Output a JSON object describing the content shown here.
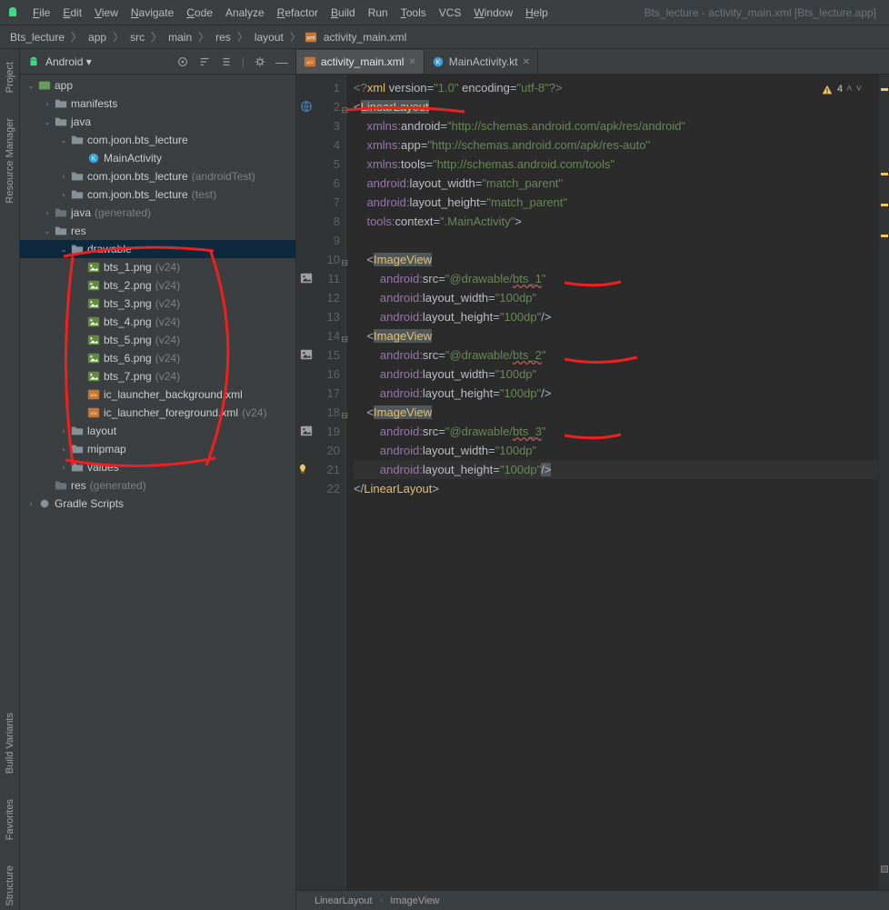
{
  "window": {
    "title": "Bts_lecture - activity_main.xml [Bts_lecture.app]"
  },
  "menu": [
    {
      "lbl": "File",
      "u": 0
    },
    {
      "lbl": "Edit",
      "u": 0
    },
    {
      "lbl": "View",
      "u": 0
    },
    {
      "lbl": "Navigate",
      "u": 0
    },
    {
      "lbl": "Code",
      "u": 0
    },
    {
      "lbl": "Analyze",
      "u": -1
    },
    {
      "lbl": "Refactor",
      "u": 0
    },
    {
      "lbl": "Build",
      "u": 0
    },
    {
      "lbl": "Run",
      "u": -1
    },
    {
      "lbl": "Tools",
      "u": 0
    },
    {
      "lbl": "VCS",
      "u": -1
    },
    {
      "lbl": "Window",
      "u": 0
    },
    {
      "lbl": "Help",
      "u": 0
    }
  ],
  "breadcrumb": [
    "Bts_lecture",
    "app",
    "src",
    "main",
    "res",
    "layout",
    "activity_main.xml"
  ],
  "leftTabs": {
    "top": [
      "Project",
      "Resource Manager"
    ],
    "bottom": [
      "Structure",
      "Favorites",
      "Build Variants"
    ]
  },
  "projHeader": {
    "title": "Android"
  },
  "tree": [
    {
      "d": 0,
      "a": "v",
      "i": "mod",
      "lbl": "app"
    },
    {
      "d": 1,
      "a": ">",
      "i": "fld",
      "lbl": "manifests"
    },
    {
      "d": 1,
      "a": "v",
      "i": "fld",
      "lbl": "java"
    },
    {
      "d": 2,
      "a": "v",
      "i": "fld",
      "lbl": "com.joon.bts_lecture"
    },
    {
      "d": 3,
      "a": "",
      "i": "kt",
      "lbl": "MainActivity"
    },
    {
      "d": 2,
      "a": ">",
      "i": "fld",
      "lbl": "com.joon.bts_lecture",
      "sub": "(androidTest)"
    },
    {
      "d": 2,
      "a": ">",
      "i": "fld",
      "lbl": "com.joon.bts_lecture",
      "sub": "(test)"
    },
    {
      "d": 1,
      "a": ">",
      "i": "fldg",
      "lbl": "java",
      "sub": "(generated)"
    },
    {
      "d": 1,
      "a": "v",
      "i": "fld",
      "lbl": "res"
    },
    {
      "d": 2,
      "a": "v",
      "i": "fld",
      "lbl": "drawable",
      "sel": true
    },
    {
      "d": 3,
      "a": "",
      "i": "img",
      "lbl": "bts_1.png",
      "sub": "(v24)"
    },
    {
      "d": 3,
      "a": "",
      "i": "img",
      "lbl": "bts_2.png",
      "sub": "(v24)"
    },
    {
      "d": 3,
      "a": "",
      "i": "img",
      "lbl": "bts_3.png",
      "sub": "(v24)"
    },
    {
      "d": 3,
      "a": "",
      "i": "img",
      "lbl": "bts_4.png",
      "sub": "(v24)"
    },
    {
      "d": 3,
      "a": "",
      "i": "img",
      "lbl": "bts_5.png",
      "sub": "(v24)"
    },
    {
      "d": 3,
      "a": "",
      "i": "img",
      "lbl": "bts_6.png",
      "sub": "(v24)"
    },
    {
      "d": 3,
      "a": "",
      "i": "img",
      "lbl": "bts_7.png",
      "sub": "(v24)"
    },
    {
      "d": 3,
      "a": "",
      "i": "xml",
      "lbl": "ic_launcher_background.xml"
    },
    {
      "d": 3,
      "a": "",
      "i": "xml",
      "lbl": "ic_launcher_foreground.xml",
      "sub": "(v24)"
    },
    {
      "d": 2,
      "a": ">",
      "i": "fld",
      "lbl": "layout"
    },
    {
      "d": 2,
      "a": ">",
      "i": "fld",
      "lbl": "mipmap"
    },
    {
      "d": 2,
      "a": ">",
      "i": "fld",
      "lbl": "values"
    },
    {
      "d": 1,
      "a": "",
      "i": "fldg",
      "lbl": "res",
      "sub": "(generated)"
    },
    {
      "d": 0,
      "a": ">",
      "i": "grd",
      "lbl": "Gradle Scripts"
    }
  ],
  "tabs": [
    {
      "lbl": "activity_main.xml",
      "icon": "xml",
      "active": true
    },
    {
      "lbl": "MainActivity.kt",
      "icon": "kt",
      "active": false
    }
  ],
  "editor": {
    "lines": [
      {
        "n": 1,
        "html": "<span class='pi'>&lt;?</span><span class='tag'>xml </span><span class='attr'>version</span><span class='op'>=</span><span class='val'>\"1.0\"</span> <span class='attr'>encoding</span><span class='op'>=</span><span class='val'>\"utf-8\"</span><span class='pi'>?&gt;</span>"
      },
      {
        "n": 2,
        "html": "<span class='op'>&lt;</span><span class='tag hl'>LinearLayout</span>",
        "icon": "globe",
        "fold": "-"
      },
      {
        "n": 3,
        "html": "    <span class='ns'>xmlns:</span><span class='attr'>android</span><span class='op'>=</span><span class='val'>\"http://schemas.android.com/apk/res/android\"</span>"
      },
      {
        "n": 4,
        "html": "    <span class='ns'>xmlns:</span><span class='attr'>app</span><span class='op'>=</span><span class='val'>\"http://schemas.android.com/apk/res-auto\"</span>"
      },
      {
        "n": 5,
        "html": "    <span class='ns'>xmlns:</span><span class='attr'>tools</span><span class='op'>=</span><span class='val'>\"http://schemas.android.com/tools\"</span>"
      },
      {
        "n": 6,
        "html": "    <span class='ns'>android:</span><span class='attr'>layout_width</span><span class='op'>=</span><span class='val'>\"match_parent\"</span>"
      },
      {
        "n": 7,
        "html": "    <span class='ns'>android:</span><span class='attr'>layout_height</span><span class='op'>=</span><span class='val'>\"match_parent\"</span>"
      },
      {
        "n": 8,
        "html": "    <span class='ns'>tools:</span><span class='attr'>context</span><span class='op'>=</span><span class='val'>\".MainActivity\"</span><span class='op'>&gt;</span>"
      },
      {
        "n": 9,
        "html": ""
      },
      {
        "n": 10,
        "html": "    <span class='op'>&lt;</span><span class='tag hl'>ImageView</span>",
        "fold": "-"
      },
      {
        "n": 11,
        "html": "        <span class='ns'>android:</span><span class='attr'>src</span><span class='op'>=</span><span class='val'>\"@drawable/<span class='err'>bts_1</span>\"</span>",
        "icon": "img"
      },
      {
        "n": 12,
        "html": "        <span class='ns'>android:</span><span class='attr'>layout_width</span><span class='op'>=</span><span class='val'>\"100dp\"</span>"
      },
      {
        "n": 13,
        "html": "        <span class='ns'>android:</span><span class='attr'>layout_height</span><span class='op'>=</span><span class='val'>\"100dp\"</span><span class='op'>/&gt;</span>",
        "fold": "–"
      },
      {
        "n": 14,
        "html": "    <span class='op'>&lt;</span><span class='tag hl'>ImageView</span>",
        "fold": "-"
      },
      {
        "n": 15,
        "html": "        <span class='ns'>android:</span><span class='attr'>src</span><span class='op'>=</span><span class='val'>\"@drawable/<span class='err'>bts_2</span>\"</span>",
        "icon": "img"
      },
      {
        "n": 16,
        "html": "        <span class='ns'>android:</span><span class='attr'>layout_width</span><span class='op'>=</span><span class='val'>\"100dp\"</span>"
      },
      {
        "n": 17,
        "html": "        <span class='ns'>android:</span><span class='attr'>layout_height</span><span class='op'>=</span><span class='val'>\"100dp\"</span><span class='op'>/&gt;</span>",
        "fold": "–"
      },
      {
        "n": 18,
        "html": "    <span class='op'>&lt;</span><span class='tag hl'>ImageView</span>",
        "fold": "-"
      },
      {
        "n": 19,
        "html": "        <span class='ns'>android:</span><span class='attr'>src</span><span class='op'>=</span><span class='val'>\"@drawable/<span class='err'>bts_3</span>\"</span>",
        "icon": "img"
      },
      {
        "n": 20,
        "html": "        <span class='ns'>android:</span><span class='attr'>layout_width</span><span class='op'>=</span><span class='val'>\"100dp\"</span>"
      },
      {
        "n": 21,
        "html": "        <span class='ns'>android:</span><span class='attr'>layout_height</span><span class='op'>=</span><span class='val'>\"100dp\"</span><span class='op hl'>/&gt;</span>",
        "cur": true,
        "bulb": true,
        "fold": "–"
      },
      {
        "n": 22,
        "html": "<span class='op'>&lt;/</span><span class='tag'>LinearLayout</span><span class='op'>&gt;</span>",
        "fold": "–"
      }
    ],
    "inspection": {
      "warn": 4
    }
  },
  "statusPath": [
    "LinearLayout",
    "ImageView"
  ],
  "annotations": {
    "tree_underline_drawable": true,
    "circle_bts_files": true,
    "editor_marks": [
      "LinearLayout",
      "bts_1",
      "bts_2",
      "bts_3"
    ]
  }
}
